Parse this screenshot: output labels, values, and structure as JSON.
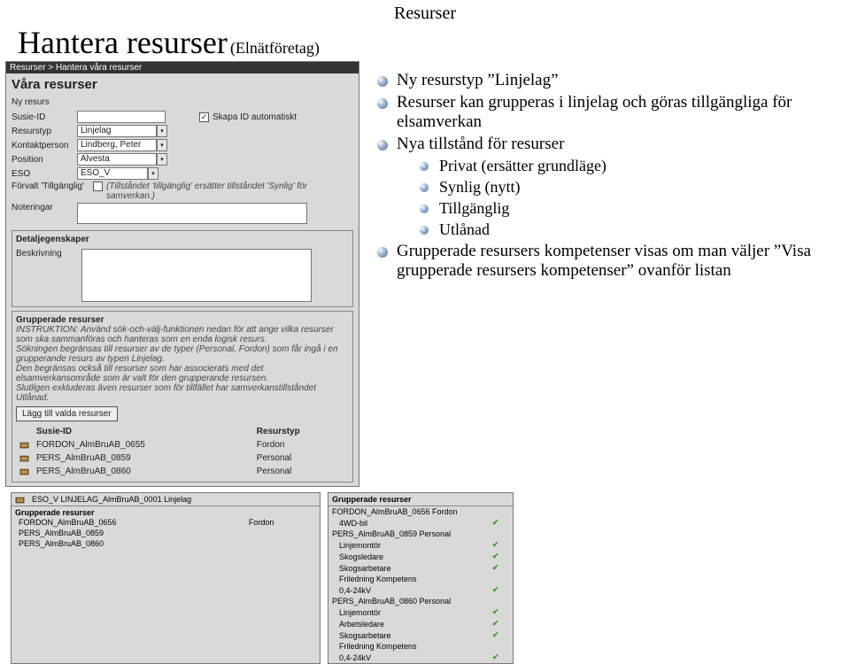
{
  "header": {
    "topic": "Resurser",
    "title": "Hantera resurser",
    "subtitle": "(Elnätföretag)"
  },
  "panel": {
    "breadcrumb": "Resurser > Hantera våra resurser",
    "heading": "Våra resurser",
    "new_link": "Ny resurs",
    "form": {
      "susie_label": "Susie-ID",
      "auto_id_label": "Skapa ID automatiskt",
      "auto_id_checked": "✓",
      "type_label": "Resurstyp",
      "type_value": "Linjelag",
      "contact_label": "Kontaktperson",
      "contact_value": "Lindberg, Peter",
      "pos_label": "Position",
      "pos_value": "Alvesta",
      "eso_label": "ESO",
      "eso_value": "ESO_V",
      "forvalt_label": "Förvalt 'Tillgänglig'",
      "forvalt_note": "(Tillståndet 'tillgänglig' ersätter tillståndet 'Synlig' för samverkan.)",
      "notes_label": "Noteringar"
    },
    "detail": {
      "legend": "Detaljegenskaper",
      "desc_label": "Beskrivning"
    },
    "grouped": {
      "legend": "Grupperade resurser",
      "instr1": "INSTRUKTION: Använd sök-och-välj-funktionen nedan för att ange vilka resurser som ska sammanföras och hanteras som en enda logisk resurs.",
      "instr2": "Sökningen begränsas till resurser av de typer (Personal, Fordon) som får ingå i en grupperande resurs av typen Linjelag.",
      "instr3": "Den begränsas också till resurser som har associerats med det elsamverkansområde som är valt för den grupperande resursen.",
      "instr4": "Slutligen exkluderas även resurser som för tillfället har samverkanstillståndet Utlånad.",
      "add_btn": "Lägg till valda resurser",
      "col1": "Susie-ID",
      "col2": "Resurstyp",
      "rows": [
        {
          "id": "FORDON_AlmBruAB_0655",
          "type": "Fordon"
        },
        {
          "id": "PERS_AlmBruAB_0859",
          "type": "Personal"
        },
        {
          "id": "PERS_AlmBruAB_0860",
          "type": "Personal"
        }
      ]
    }
  },
  "mini1": {
    "row_id": "ESO_V  LINJELAG_AlmBruAB_0001  Linjelag",
    "legend": "Grupperade resurser",
    "rows": [
      {
        "id": "FORDON_AlmBruAB_0656",
        "type": "Fordon"
      },
      {
        "id": "PERS_AlmBruAB_0859",
        "type": ""
      },
      {
        "id": "PERS_AlmBruAB_0860",
        "type": ""
      }
    ]
  },
  "mini2": {
    "legend": "Grupperade resurser",
    "row0": "FORDON_AlmBruAB_0656 Fordon",
    "s1": "4WD-bil",
    "row1": "PERS_AlmBruAB_0859    Personal",
    "c1": "Linjemontör",
    "c2": "Skogsledare",
    "c3": "Skogsarbetare",
    "c4": "Friledning Kompetens",
    "c5": "0,4-24kV",
    "row2": "PERS_AlmBruAB_0860    Personal",
    "d1": "Linjemontör",
    "d2": "Arbetsledare",
    "d3": "Skogsarbetare",
    "d4": "Friledning Kompetens",
    "d5": "0,4-24kV"
  },
  "bullets": {
    "b1": "Ny resurstyp ”Linjelag”",
    "b2": "Resurser kan grupperas i linjelag och göras tillgängliga för elsamverkan",
    "b3": "Nya tillstånd för resurser",
    "b3a": "Privat (ersätter grundläge)",
    "b3b": "Synlig (nytt)",
    "b3c": "Tillgänglig",
    "b3d": "Utlånad",
    "b4": "Grupperade resursers kompetenser visas om man väljer ”Visa grupperade resursers kompetenser” ovanför listan"
  }
}
